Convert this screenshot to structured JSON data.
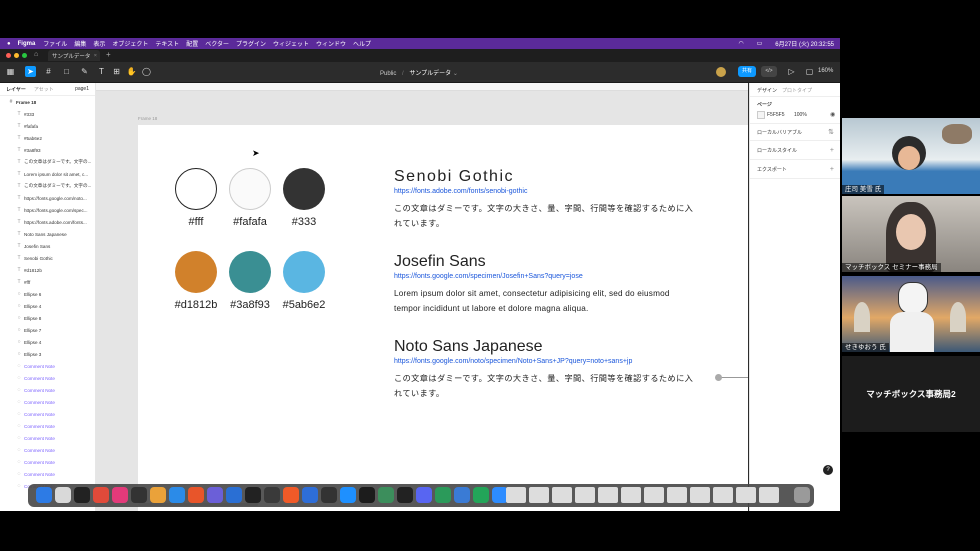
{
  "menubar": {
    "app": "Figma",
    "items": [
      "ファイル",
      "編集",
      "表示",
      "オブジェクト",
      "テキスト",
      "配置",
      "ベクター",
      "プラグイン",
      "ウィジェット",
      "ウィンドウ",
      "ヘルプ"
    ],
    "clock": "6月27日 (火)  20:32:55"
  },
  "tab": {
    "file_name": "サンプルデータ"
  },
  "toolbar": {
    "breadcrumb_team": "Public",
    "breadcrumb_file": "サンプルデータ",
    "share_label": "共有",
    "zoom": "160%"
  },
  "left_panel": {
    "tabs": [
      "レイヤー",
      "アセット",
      "page1"
    ],
    "layers": [
      {
        "name": "Frame 18",
        "type": "frame"
      },
      {
        "name": "#333",
        "type": "text"
      },
      {
        "name": "#fafafa",
        "type": "text"
      },
      {
        "name": "#5ab6e2",
        "type": "text"
      },
      {
        "name": "#3a8f93",
        "type": "text"
      },
      {
        "name": "この文章はダミーです。文字の...",
        "type": "text"
      },
      {
        "name": "Lorem ipsum dolor sit amet, c...",
        "type": "text"
      },
      {
        "name": "この文章はダミーです。文字の...",
        "type": "text"
      },
      {
        "name": "https://fonts.google.com/noto...",
        "type": "text"
      },
      {
        "name": "https://fonts.google.com/spec...",
        "type": "text"
      },
      {
        "name": "https://fonts.adobe.com/fonts...",
        "type": "text"
      },
      {
        "name": "Noto Sans Japanese",
        "type": "text"
      },
      {
        "name": "Josefin Sans",
        "type": "text"
      },
      {
        "name": "Senobi Gothic",
        "type": "text"
      },
      {
        "name": "#d1812b",
        "type": "text"
      },
      {
        "name": "#fff",
        "type": "text"
      },
      {
        "name": "Ellipse 6",
        "type": "ellipse"
      },
      {
        "name": "Ellipse 4",
        "type": "ellipse"
      },
      {
        "name": "Ellipse 8",
        "type": "ellipse"
      },
      {
        "name": "Ellipse 7",
        "type": "ellipse"
      },
      {
        "name": "Ellipse 4",
        "type": "ellipse"
      },
      {
        "name": "Ellipse 3",
        "type": "ellipse"
      },
      {
        "name": "Comment Note",
        "type": "note"
      },
      {
        "name": "Comment Note",
        "type": "note"
      },
      {
        "name": "Comment Note",
        "type": "note"
      },
      {
        "name": "Comment Note",
        "type": "note"
      },
      {
        "name": "Comment Note",
        "type": "note"
      },
      {
        "name": "Comment Note",
        "type": "note"
      },
      {
        "name": "Comment Note",
        "type": "note"
      },
      {
        "name": "Comment Note",
        "type": "note"
      },
      {
        "name": "Comment Note",
        "type": "note"
      },
      {
        "name": "Comment Note",
        "type": "note"
      },
      {
        "name": "Comment Note",
        "type": "note"
      }
    ]
  },
  "canvas": {
    "frame_label": "Frame 18",
    "swatches": [
      {
        "label": "#fff",
        "color": "#ffffff"
      },
      {
        "label": "#fafafa",
        "color": "#fafafa"
      },
      {
        "label": "#333",
        "color": "#333333"
      },
      {
        "label": "#d1812b",
        "color": "#d1812b"
      },
      {
        "label": "#3a8f93",
        "color": "#3a8f93"
      },
      {
        "label": "#5ab6e2",
        "color": "#5ab6e2"
      }
    ],
    "fonts": [
      {
        "title": "Senobi Gothic",
        "link": "https://fonts.adobe.com/fonts/senobi-gothic",
        "sample": "この文章はダミーです。文字の大きさ、量、字間、行間等を確認するために入れています。"
      },
      {
        "title": "Josefin Sans",
        "link": "https://fonts.google.com/specimen/Josefin+Sans?query=jose",
        "sample": "Lorem ipsum dolor sit amet, consectetur adipisicing elit, sed do eiusmod tempor incididunt ut labore et dolore magna aliqua."
      },
      {
        "title": "Noto Sans Japanese",
        "link": "https://fonts.google.com/noto/specimen/Noto+Sans+JP?query=noto+sans+jp",
        "sample": "この文章はダミーです。文字の大きさ、量、字間、行間等を確認するために入れています。"
      }
    ]
  },
  "right_panel": {
    "tabs": [
      "デザイン",
      "プロトタイプ"
    ],
    "page_section": "ページ",
    "bg_color": "F5F5F5",
    "bg_opacity": "100%",
    "sections": [
      "ローカルバリアブル",
      "ローカルスタイル",
      "エクスポート"
    ]
  },
  "video_tiles": [
    {
      "name": "庄司 美雪 氏"
    },
    {
      "name": "マッチボックス セミナー事務局"
    },
    {
      "name": "せきゆおう 氏"
    },
    {
      "name": "マッチボックス事務局2"
    }
  ]
}
